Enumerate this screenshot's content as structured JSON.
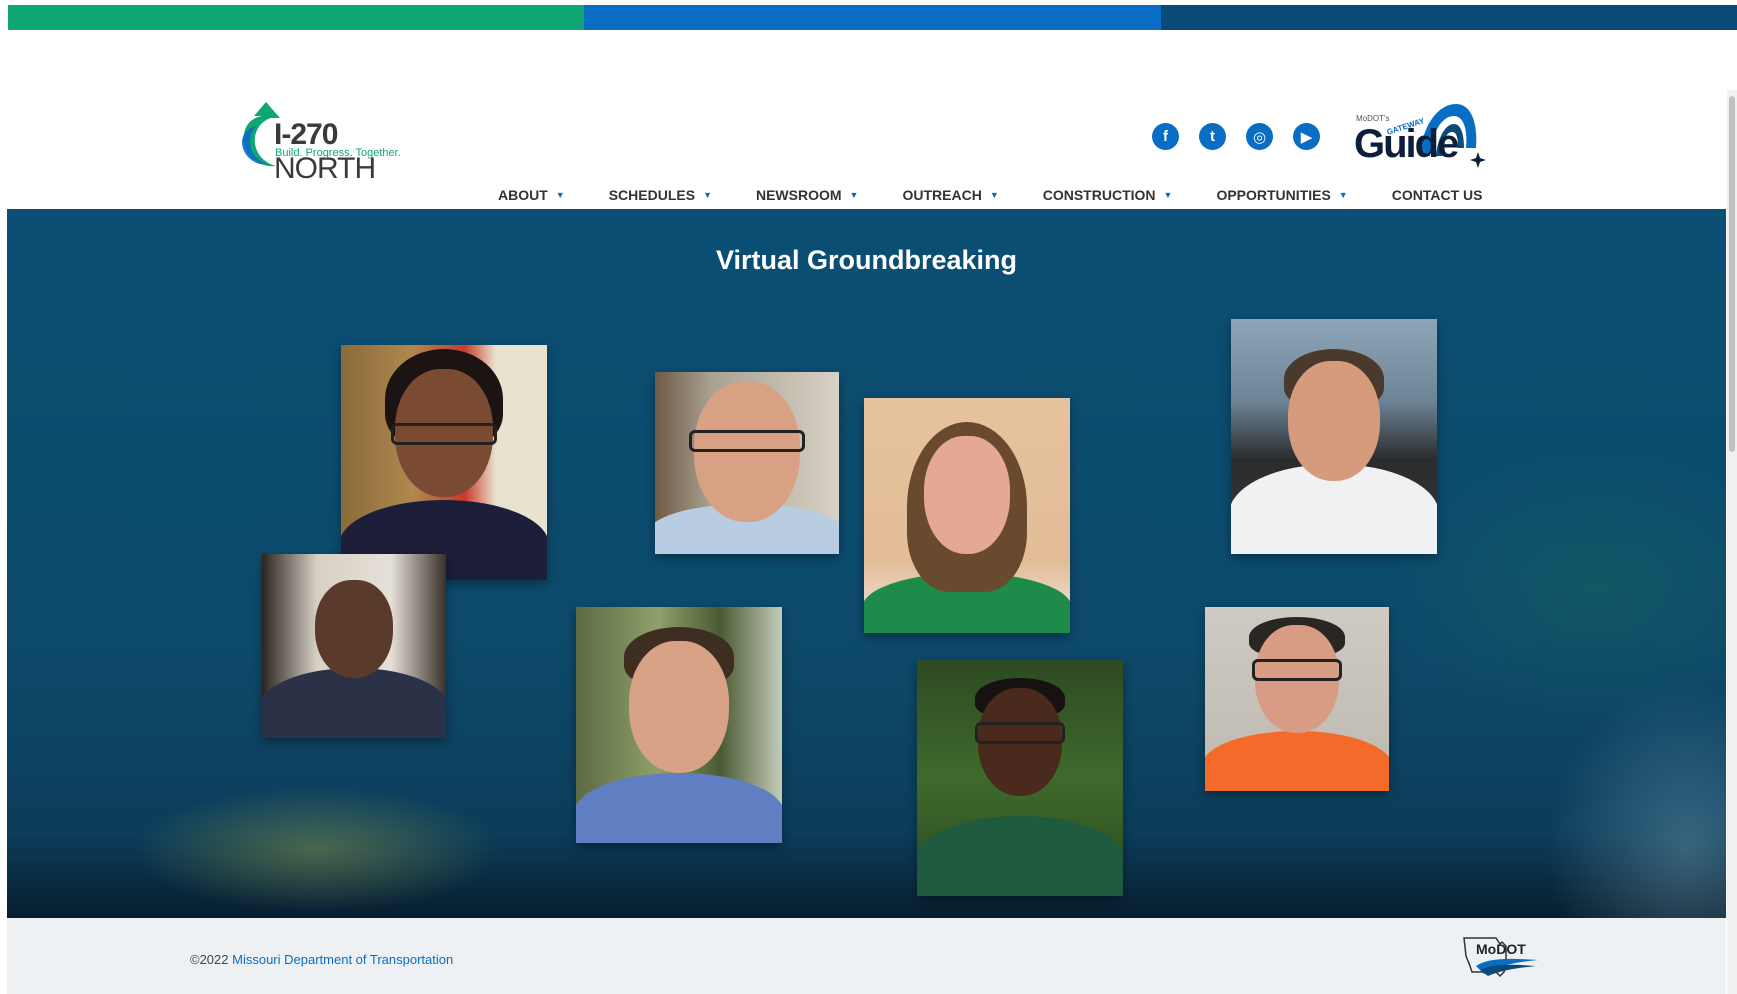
{
  "brand": {
    "logo_bold": "I-270",
    "logo_thin": " NORTH",
    "tagline": "Build. Progress. Together.",
    "guide_small": "MoDOT's",
    "guide_gateway": "GATEWAY",
    "guide_word": "Guide"
  },
  "social": [
    {
      "icon": "facebook-icon",
      "glyph": "f"
    },
    {
      "icon": "twitter-icon",
      "glyph": "t"
    },
    {
      "icon": "instagram-icon",
      "glyph": "◎"
    },
    {
      "icon": "youtube-icon",
      "glyph": "▶"
    }
  ],
  "nav": {
    "items": [
      {
        "label": "ABOUT",
        "dropdown": true
      },
      {
        "label": "SCHEDULES",
        "dropdown": true
      },
      {
        "label": "NEWSROOM",
        "dropdown": true
      },
      {
        "label": "OUTREACH",
        "dropdown": true
      },
      {
        "label": "CONSTRUCTION",
        "dropdown": true
      },
      {
        "label": "OPPORTUNITIES",
        "dropdown": true
      },
      {
        "label": "CONTACT US",
        "dropdown": false
      }
    ],
    "caret": "▼"
  },
  "hero": {
    "title": "Virtual Groundbreaking"
  },
  "footer": {
    "copyright": "©2022 ",
    "link": "Missouri Department of Transportation",
    "modot_logo": "MoDOT"
  },
  "colors": {
    "green": "#0fa674",
    "blue": "#0a6dc4",
    "navy": "#0b4a78",
    "hero": "#0d4a6b"
  }
}
